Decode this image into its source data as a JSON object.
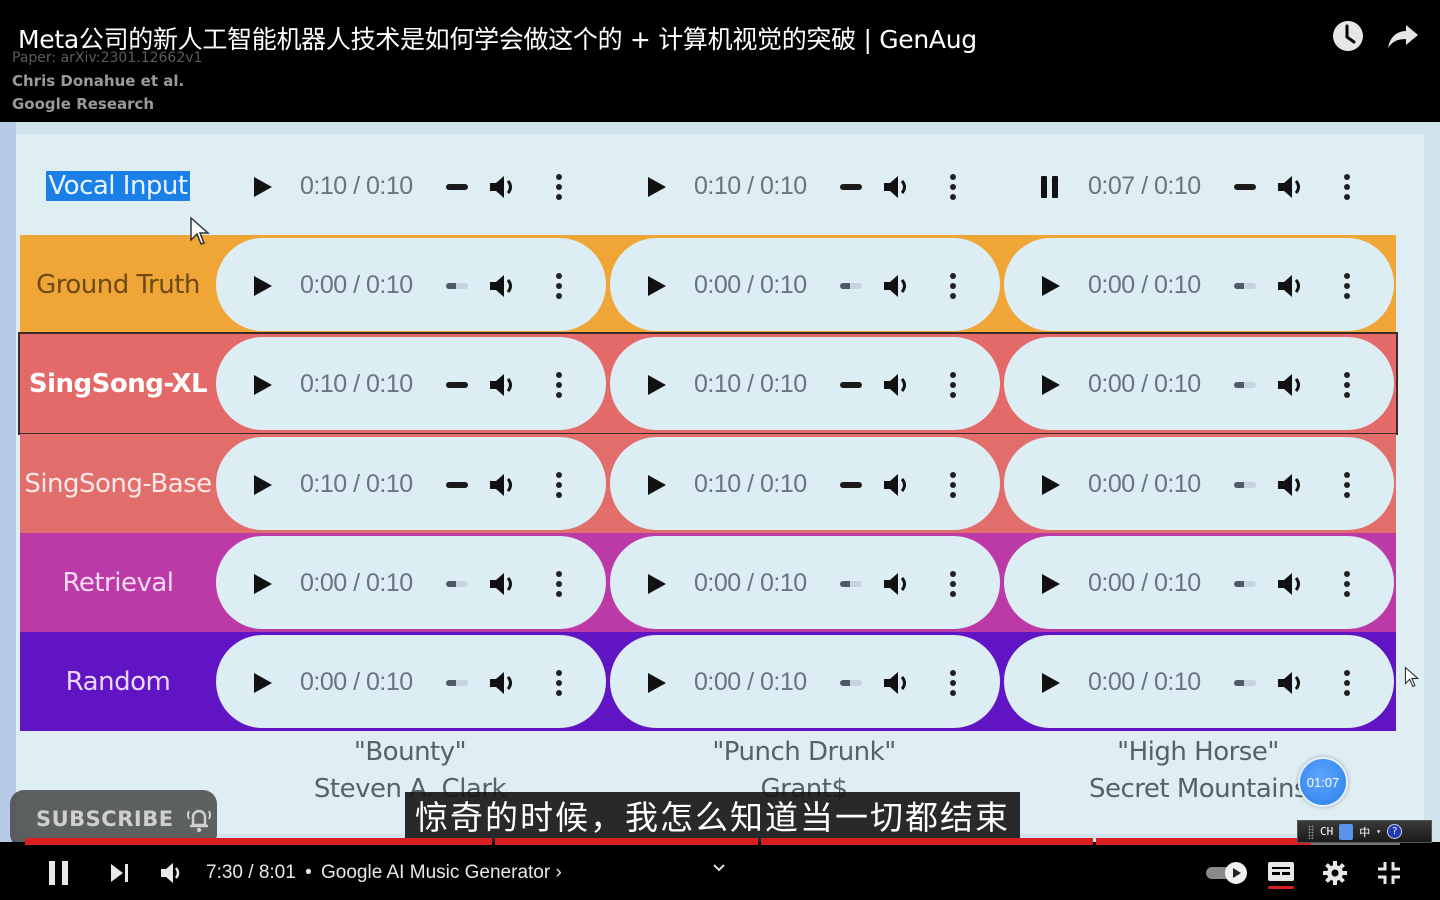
{
  "video": {
    "title": "Meta公司的新人工智能机器人技术是如何学会做这个的 + 计算机视觉的突破 | GenAug",
    "paper_lines": [
      "Paper: arXiv:2301.12662v1",
      "Chris Donahue et al.",
      "Google Research"
    ],
    "top_actions": [
      {
        "name": "watch-later",
        "icon": "clock-icon"
      },
      {
        "name": "share",
        "icon": "share-arrow-icon"
      }
    ]
  },
  "slide": {
    "rows": [
      {
        "label": "Vocal Input",
        "bg": "#dfeef3",
        "text_color": "#1b7fe8",
        "selected": true,
        "players": [
          {
            "state": "played",
            "time": "0:10 / 0:10",
            "progress": 1.0
          },
          {
            "state": "played",
            "time": "0:10 / 0:10",
            "progress": 1.0
          },
          {
            "state": "playing",
            "time": "0:07 / 0:10",
            "progress": 0.7
          }
        ]
      },
      {
        "label": "Ground Truth",
        "bg": "#f0a537",
        "text_color": "#6b4a14",
        "selected": false,
        "players": [
          {
            "state": "idle",
            "time": "0:00 / 0:10",
            "progress": 0
          },
          {
            "state": "idle",
            "time": "0:00 / 0:10",
            "progress": 0
          },
          {
            "state": "idle",
            "time": "0:00 / 0:10",
            "progress": 0
          }
        ]
      },
      {
        "label": "SingSong-XL",
        "bg": "#e36a68",
        "text_color": "#ffffff",
        "bold": true,
        "outlined": true,
        "players": [
          {
            "state": "played",
            "time": "0:10 / 0:10",
            "progress": 1.0
          },
          {
            "state": "played",
            "time": "0:10 / 0:10",
            "progress": 1.0
          },
          {
            "state": "idle",
            "time": "0:00 / 0:10",
            "progress": 0
          }
        ]
      },
      {
        "label": "SingSong-Base",
        "bg": "#e26e6c",
        "text_color": "#ffe8ea",
        "players": [
          {
            "state": "played",
            "time": "0:10 / 0:10",
            "progress": 1.0
          },
          {
            "state": "played",
            "time": "0:10 / 0:10",
            "progress": 1.0
          },
          {
            "state": "idle",
            "time": "0:00 / 0:10",
            "progress": 0
          }
        ]
      },
      {
        "label": "Retrieval",
        "bg": "#bb3aa8",
        "text_color": "#f6dcf2",
        "players": [
          {
            "state": "idle",
            "time": "0:00 / 0:10",
            "progress": 0
          },
          {
            "state": "idle",
            "time": "0:00 / 0:10",
            "progress": 0
          },
          {
            "state": "idle",
            "time": "0:00 / 0:10",
            "progress": 0
          }
        ]
      },
      {
        "label": "Random",
        "bg": "#6114c4",
        "text_color": "#ead8ff",
        "players": [
          {
            "state": "idle",
            "time": "0:00 / 0:10",
            "progress": 0
          },
          {
            "state": "idle",
            "time": "0:00 / 0:10",
            "progress": 0
          },
          {
            "state": "idle",
            "time": "0:00 / 0:10",
            "progress": 0
          }
        ]
      }
    ],
    "columns": [
      {
        "song": "\"Bounty\"",
        "artist": "Steven A. Clark"
      },
      {
        "song": "\"Punch Drunk\"",
        "artist": "Grant$"
      },
      {
        "song": "\"High Horse\"",
        "artist": "Secret Mountains"
      }
    ],
    "timer_badge": "01:07"
  },
  "overlay": {
    "subscribe_label": "SUBSCRIBE",
    "subtitle": "惊奇的时候，我怎么知道当一切都结束"
  },
  "player_controls": {
    "current_time": "7:30",
    "duration": "8:01",
    "time_display": "7:30 / 8:01",
    "separator": "•",
    "chapter": "Google AI Music Generator",
    "chapter_chevron": "›",
    "progress_fraction": 0.935,
    "chapter_boundaries_fraction": [
      0.342,
      0.535,
      0.779
    ],
    "autoplay": true,
    "captions_on": true,
    "accent": "#d81e1e"
  },
  "ime_toolbar": {
    "lang": "CH",
    "mode": "中",
    "help": "?"
  }
}
